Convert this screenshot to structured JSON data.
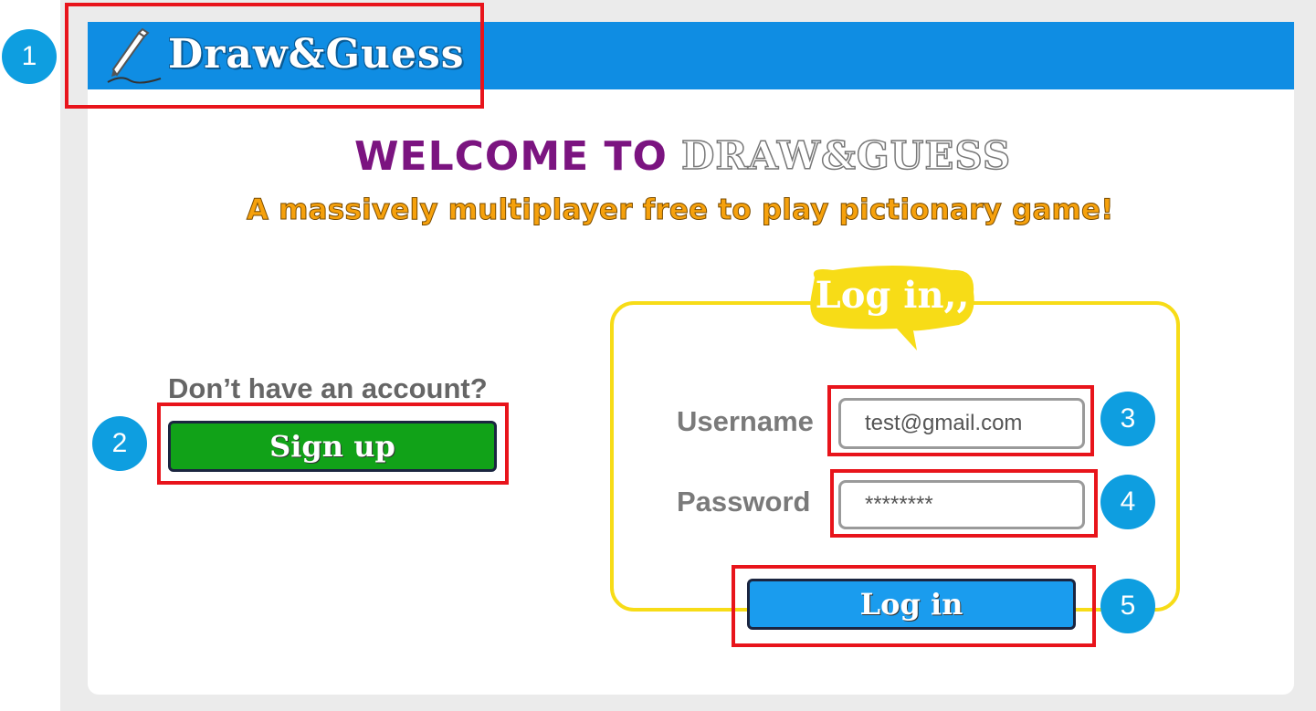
{
  "header": {
    "logo_text": "Draw&Guess"
  },
  "welcome": {
    "prefix": "WELCOME TO",
    "brand": "DRAW&GUESS"
  },
  "tagline": "A massively multiplayer free to play pictionary game!",
  "signup": {
    "question": "Don’t have an account?",
    "button_label": "Sign up"
  },
  "login": {
    "title": "Log in,,",
    "username_label": "Username",
    "username_value": "test@gmail.com",
    "password_label": "Password",
    "password_value": "********",
    "button_label": "Log in"
  },
  "annotations": [
    "1",
    "2",
    "3",
    "4",
    "5"
  ],
  "colors": {
    "header_blue": "#0f8de3",
    "welcome_purple": "#7b1480",
    "tagline_orange": "#f6a10c",
    "signup_green": "#11a218",
    "login_blue": "#1a9cee",
    "login_yellow": "#f7dc17",
    "annotation_red": "#e8141b",
    "badge_blue": "#0e9ee0"
  }
}
